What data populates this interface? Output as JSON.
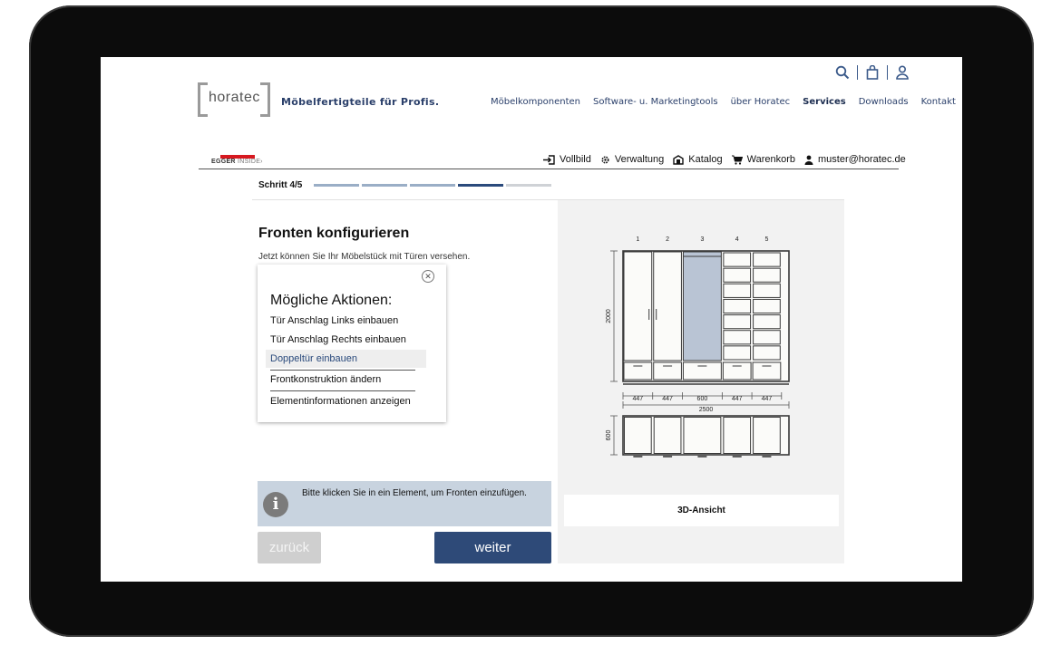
{
  "brand": {
    "logo_word": "horatec",
    "tagline": "Möbelfertigteile für Profis."
  },
  "nav": {
    "items": [
      "Möbelkomponenten",
      "Software- u. Marketingtools",
      "über Horatec",
      "Services",
      "Downloads",
      "Kontakt"
    ],
    "active": "Services"
  },
  "egger": {
    "brand": "EGGER",
    "suffix": "INSIDE›",
    "color": "#d71920"
  },
  "toolbar": {
    "fullscreen": "Vollbild",
    "admin": "Verwaltung",
    "catalog": "Katalog",
    "cart": "Warenkorb",
    "user": "muster@horatec.de"
  },
  "step": {
    "label": "Schritt 4/5",
    "current": 4,
    "total": 5
  },
  "content": {
    "title": "Fronten konfigurieren",
    "subtitle": "Jetzt können Sie Ihr Möbelstück mit Türen versehen."
  },
  "menu": {
    "heading": "Mögliche Aktionen:",
    "items": [
      "Tür Anschlag Links einbauen",
      "Tür Anschlag Rechts einbauen",
      "Doppeltür einbauen",
      "Frontkonstruktion ändern",
      "Elementinformationen anzeigen"
    ],
    "highlighted": "Doppeltür einbauen"
  },
  "info": {
    "text": "Bitte klicken Sie in ein Element, um Fronten einzufügen."
  },
  "buttons": {
    "back": "zurück",
    "next": "weiter",
    "view3d": "3D-Ansicht"
  },
  "drawing": {
    "column_numbers": [
      "1",
      "2",
      "3",
      "4",
      "5"
    ],
    "column_widths": [
      "447",
      "447",
      "600",
      "447",
      "447"
    ],
    "total_width": "2500",
    "height": "2000",
    "depth": "600",
    "selected_column": 3,
    "selected_color": "#b9c4d4"
  },
  "colors": {
    "accent": "#2e4a78",
    "nav": "#2a3f6a",
    "info_bg": "#c8d3df"
  }
}
